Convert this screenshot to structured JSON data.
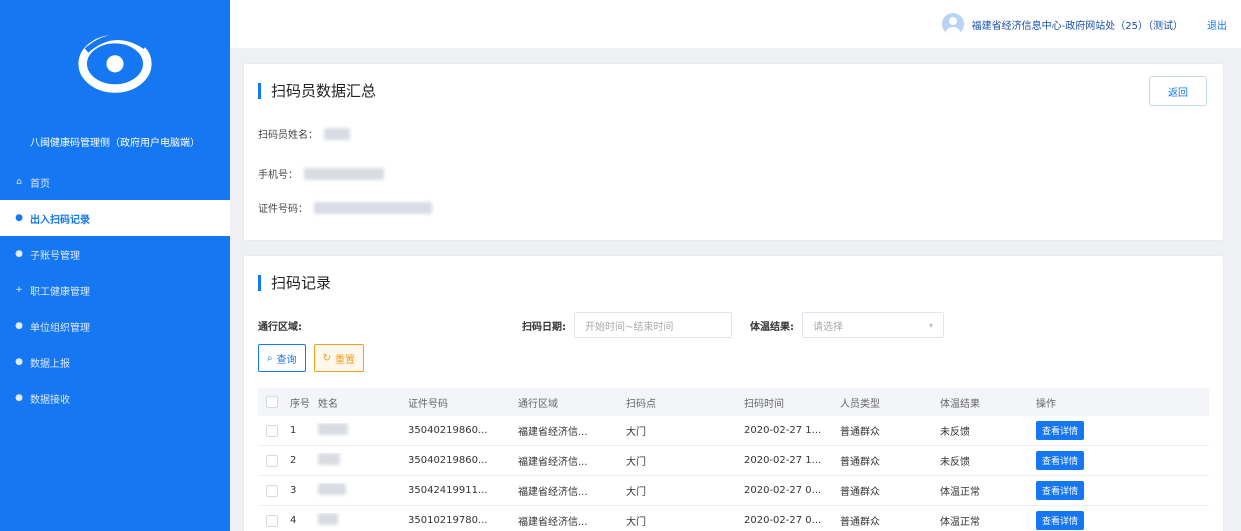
{
  "sidebar": {
    "system_title": "八闽健康码管理侧（政府用户电脑端）",
    "items": [
      {
        "label": "首页",
        "icon": "home-icon",
        "active": false
      },
      {
        "label": "出入扫码记录",
        "icon": "database-icon",
        "active": true
      },
      {
        "label": "子账号管理",
        "icon": "database-icon",
        "active": false
      },
      {
        "label": "职工健康管理",
        "icon": "plus-icon",
        "active": false
      },
      {
        "label": "单位组织管理",
        "icon": "database-icon",
        "active": false
      },
      {
        "label": "数据上报",
        "icon": "database-icon",
        "active": false
      },
      {
        "label": "数据接收",
        "icon": "database-icon",
        "active": false
      }
    ]
  },
  "header": {
    "user_text": "福建省经济信息中心-政府网站处（25）（测试）",
    "logout_label": "退出"
  },
  "summary": {
    "title": "扫码员数据汇总",
    "back_label": "返回",
    "name_label": "扫码员姓名：",
    "phone_label": "手机号：",
    "id_label": "证件号码："
  },
  "records": {
    "title": "扫码记录",
    "filters": {
      "area_label": "通行区域:",
      "date_label": "扫码日期:",
      "date_placeholder": "开始时间~结束时间",
      "temp_label": "体温结果:",
      "temp_placeholder": "请选择"
    },
    "search_label": "查询",
    "reset_label": "重置",
    "columns": [
      "序号",
      "姓名",
      "证件号码",
      "通行区域",
      "扫码点",
      "扫码时间",
      "人员类型",
      "体温结果",
      "操作"
    ],
    "rows": [
      {
        "no": "1",
        "id": "35040219860...",
        "area": "福建省经济信...",
        "point": "大门",
        "time": "2020-02-27 1...",
        "type": "普通群众",
        "temp": "未反馈",
        "action": "查看详情"
      },
      {
        "no": "2",
        "id": "35040219860...",
        "area": "福建省经济信...",
        "point": "大门",
        "time": "2020-02-27 1...",
        "type": "普通群众",
        "temp": "未反馈",
        "action": "查看详情"
      },
      {
        "no": "3",
        "id": "35042419911...",
        "area": "福建省经济信...",
        "point": "大门",
        "time": "2020-02-27 0...",
        "type": "普通群众",
        "temp": "体温正常",
        "action": "查看详情"
      },
      {
        "no": "4",
        "id": "35010219780...",
        "area": "福建省经济信...",
        "point": "大门",
        "time": "2020-02-27 0...",
        "type": "普通群众",
        "temp": "体温正常",
        "action": "查看详情"
      }
    ]
  }
}
